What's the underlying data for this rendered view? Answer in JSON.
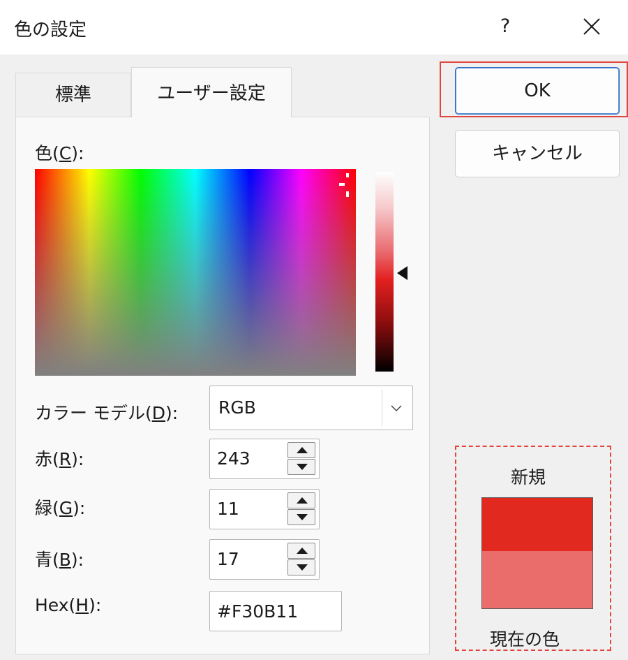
{
  "window": {
    "title": "色の設定",
    "help_label": "?"
  },
  "tabs": [
    {
      "label": "標準"
    },
    {
      "label": "ユーザー設定"
    }
  ],
  "color_picker": {
    "label_prefix": "色(",
    "label_key": "C",
    "label_suffix": "):"
  },
  "color_model": {
    "label_prefix": "カラー モデル(",
    "label_key": "D",
    "label_suffix": "):",
    "value": "RGB"
  },
  "red": {
    "label_prefix": "赤(",
    "label_key": "R",
    "label_suffix": "):",
    "value": "243"
  },
  "green": {
    "label_prefix": "緑(",
    "label_key": "G",
    "label_suffix": "):",
    "value": "11"
  },
  "blue": {
    "label_prefix": "青(",
    "label_key": "B",
    "label_suffix": "):",
    "value": "17"
  },
  "hex": {
    "label_prefix": "Hex(",
    "label_key": "H",
    "label_suffix": "):",
    "value": "#F30B11"
  },
  "buttons": {
    "ok": "OK",
    "cancel": "キャンセル"
  },
  "preview": {
    "new_label": "新規",
    "current_label": "現在の色",
    "new_color": "#E2291F",
    "current_color": "#EA6D6B"
  },
  "colors": {
    "highlight": "#E2453E",
    "ok_border": "#2F6CC4"
  }
}
